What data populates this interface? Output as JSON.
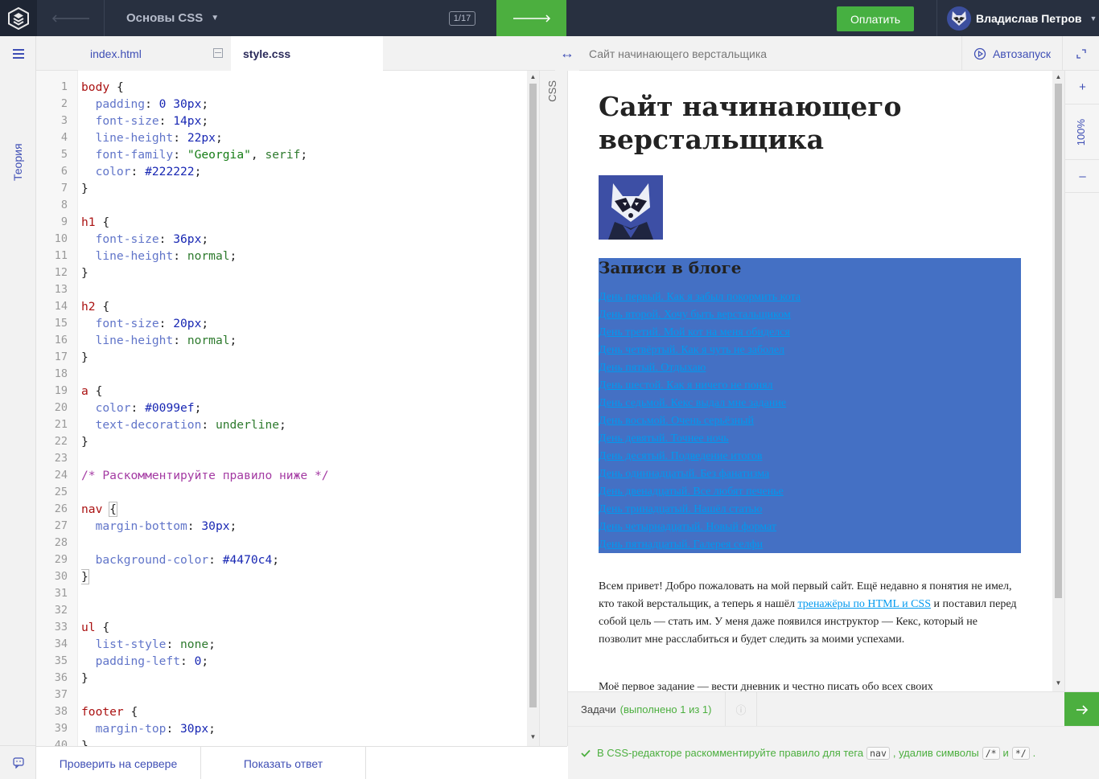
{
  "topbar": {
    "course_title": "Основы CSS",
    "progress": "1/17",
    "pay_label": "Оплатить",
    "user_name": "Владислав Петров"
  },
  "sidebar": {
    "theory_label": "Теория"
  },
  "tabs": [
    {
      "label": "index.html",
      "active": false
    },
    {
      "label": "style.css",
      "active": true
    }
  ],
  "editor": {
    "mode_label": "CSS",
    "lines": [
      [
        [
          "sel",
          "body"
        ],
        [
          "br",
          " {"
        ]
      ],
      [
        [
          "prop",
          "  padding"
        ],
        [
          "br",
          ": "
        ],
        [
          "num",
          "0 30px"
        ],
        [
          "br",
          ";"
        ]
      ],
      [
        [
          "prop",
          "  font-size"
        ],
        [
          "br",
          ": "
        ],
        [
          "num",
          "14px"
        ],
        [
          "br",
          ";"
        ]
      ],
      [
        [
          "prop",
          "  line-height"
        ],
        [
          "br",
          ": "
        ],
        [
          "num",
          "22px"
        ],
        [
          "br",
          ";"
        ]
      ],
      [
        [
          "prop",
          "  font-family"
        ],
        [
          "br",
          ": "
        ],
        [
          "str",
          "\"Georgia\""
        ],
        [
          "br",
          ", "
        ],
        [
          "kw",
          "serif"
        ],
        [
          "br",
          ";"
        ]
      ],
      [
        [
          "prop",
          "  color"
        ],
        [
          "br",
          ": "
        ],
        [
          "num",
          "#222222"
        ],
        [
          "br",
          ";"
        ]
      ],
      [
        [
          "br",
          "}"
        ]
      ],
      [],
      [
        [
          "sel",
          "h1"
        ],
        [
          "br",
          " {"
        ]
      ],
      [
        [
          "prop",
          "  font-size"
        ],
        [
          "br",
          ": "
        ],
        [
          "num",
          "36px"
        ],
        [
          "br",
          ";"
        ]
      ],
      [
        [
          "prop",
          "  line-height"
        ],
        [
          "br",
          ": "
        ],
        [
          "kw",
          "normal"
        ],
        [
          "br",
          ";"
        ]
      ],
      [
        [
          "br",
          "}"
        ]
      ],
      [],
      [
        [
          "sel",
          "h2"
        ],
        [
          "br",
          " {"
        ]
      ],
      [
        [
          "prop",
          "  font-size"
        ],
        [
          "br",
          ": "
        ],
        [
          "num",
          "20px"
        ],
        [
          "br",
          ";"
        ]
      ],
      [
        [
          "prop",
          "  line-height"
        ],
        [
          "br",
          ": "
        ],
        [
          "kw",
          "normal"
        ],
        [
          "br",
          ";"
        ]
      ],
      [
        [
          "br",
          "}"
        ]
      ],
      [],
      [
        [
          "sel",
          "a"
        ],
        [
          "br",
          " {"
        ]
      ],
      [
        [
          "prop",
          "  color"
        ],
        [
          "br",
          ": "
        ],
        [
          "num",
          "#0099ef"
        ],
        [
          "br",
          ";"
        ]
      ],
      [
        [
          "prop",
          "  text-decoration"
        ],
        [
          "br",
          ": "
        ],
        [
          "kw",
          "underline"
        ],
        [
          "br",
          ";"
        ]
      ],
      [
        [
          "br",
          "}"
        ]
      ],
      [],
      [
        [
          "cmt",
          "/* Раскомментируйте правило ниже */"
        ]
      ],
      [],
      [
        [
          "sel",
          "nav"
        ],
        [
          "br",
          " "
        ],
        [
          "mb",
          "{"
        ]
      ],
      [
        [
          "prop",
          "  margin-bottom"
        ],
        [
          "br",
          ": "
        ],
        [
          "num",
          "30px"
        ],
        [
          "br",
          ";"
        ]
      ],
      [],
      [
        [
          "prop",
          "  background-color"
        ],
        [
          "br",
          ": "
        ],
        [
          "num",
          "#4470c4"
        ],
        [
          "br",
          ";"
        ]
      ],
      [
        [
          "mb",
          "}"
        ]
      ],
      [],
      [],
      [
        [
          "sel",
          "ul"
        ],
        [
          "br",
          " {"
        ]
      ],
      [
        [
          "prop",
          "  list-style"
        ],
        [
          "br",
          ": "
        ],
        [
          "kw",
          "none"
        ],
        [
          "br",
          ";"
        ]
      ],
      [
        [
          "prop",
          "  padding-left"
        ],
        [
          "br",
          ": "
        ],
        [
          "num",
          "0"
        ],
        [
          "br",
          ";"
        ]
      ],
      [
        [
          "br",
          "}"
        ]
      ],
      [],
      [
        [
          "sel",
          "footer"
        ],
        [
          "br",
          " {"
        ]
      ],
      [
        [
          "prop",
          "  margin-top"
        ],
        [
          "br",
          ": "
        ],
        [
          "num",
          "30px"
        ],
        [
          "br",
          ";"
        ]
      ],
      [
        [
          "br",
          "}"
        ]
      ]
    ]
  },
  "bottom": {
    "check_label": "Проверить на сервере",
    "answer_label": "Показать ответ"
  },
  "preview": {
    "header_title": "Сайт начинающего верстальщика",
    "autorun_label": "Автозапуск",
    "zoom_label": "100%",
    "h1": "Сайт начинающего верстальщика",
    "nav_heading": "Записи в блоге",
    "nav_links": [
      "День первый. Как я забыл покормить кота",
      "День второй. Хочу быть верстальщиком",
      "День третий. Мой кот на меня обиделся",
      "День четвёртый. Как я чуть не заболел",
      "День пятый. Отдыхаю",
      "День шестой. Как я ничего не понял",
      "День седьмой. Кекс выдал мне задание",
      "День восьмой. Очень серьёзный",
      "День девятый. Точнее ночь",
      "День десятый. Подведение итогов",
      "День одиннадцатый. Без фанатизма",
      "День двенадцатый. Все любят печенье",
      "День тринадцатый. Нашёл статью",
      "День четырнадцатый. Новый формат",
      "День пятнадцатый. Галерея селфи"
    ],
    "intro_before": "Всем привет! Добро пожаловать на мой первый сайт. Ещё недавно я понятия не имел, кто такой верстальщик, а теперь я нашёл ",
    "intro_link": "тренажёры по HTML и CSS",
    "intro_after": " и поставил перед собой цель — стать им. У меня даже появился инструктор — Кекс, который не позволит мне расслабиться и будет следить за моими успехами.",
    "intro2": "Моё первое задание — вести дневник и честно писать обо всех своих"
  },
  "tasks": {
    "label": "Задачи",
    "status": "(выполнено 1 из 1)",
    "message_before": "В CSS-редакторе раскомментируйте правило для тега",
    "code1": "nav",
    "message_mid": ", удалив символы",
    "code2": "/*",
    "message_and": "и",
    "code3": "*/",
    "message_end": "."
  },
  "colors": {
    "topbar": "#283040",
    "accent_green": "#4caf3f",
    "nav_bg": "#4470c4",
    "link": "#0099ef"
  }
}
